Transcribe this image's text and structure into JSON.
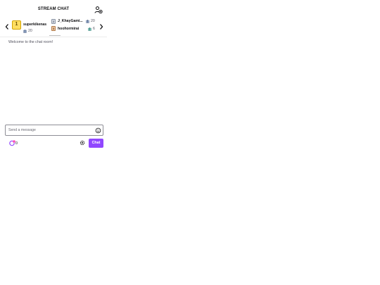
{
  "header": {
    "title": "STREAM CHAT",
    "users_icon": "users-icon"
  },
  "leaderboard": {
    "top": {
      "rank": "1",
      "name": "superkikenas",
      "count": "20"
    },
    "others": [
      {
        "rank": "2",
        "name": "J_KhayGami...",
        "count": "20"
      },
      {
        "rank": "3",
        "name": "hoohormirai",
        "count": "6"
      }
    ],
    "prev_icon": "chevron-left-icon",
    "next_icon": "chevron-right-icon"
  },
  "messages": {
    "welcome": "Welcome to the chat room!"
  },
  "input": {
    "placeholder": "Send a message",
    "value": "",
    "emote_icon": "smiley-icon"
  },
  "footer": {
    "points": "0",
    "chat_label": "Chat",
    "settings_icon": "gear-icon"
  },
  "colors": {
    "accent": "#9147ff",
    "gold": "#ffde61",
    "silver": "#d8dde6",
    "bronze": "#f0c9a4"
  }
}
